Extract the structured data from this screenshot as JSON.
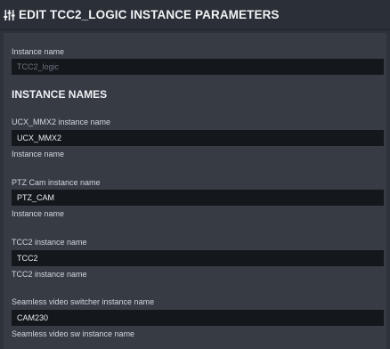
{
  "header": {
    "title": "EDIT TCC2_LOGIC INSTANCE PARAMETERS",
    "icon": "sliders-icon"
  },
  "instance": {
    "label": "Instance name",
    "value": "TCC2_logic"
  },
  "section_title": "INSTANCE NAMES",
  "fields": [
    {
      "label": "UCX_MMX2 instance name",
      "value": "UCX_MMX2",
      "hint": "Instance name"
    },
    {
      "label": "PTZ Cam instance name",
      "value": "PTZ_CAM",
      "hint": "Instance name"
    },
    {
      "label": "TCC2 instance name",
      "value": "TCC2",
      "hint": "TCC2 instance name"
    },
    {
      "label": "Seamless video switcher instance name",
      "value": "CAM230",
      "hint": "Seamless video sw instance name"
    }
  ]
}
